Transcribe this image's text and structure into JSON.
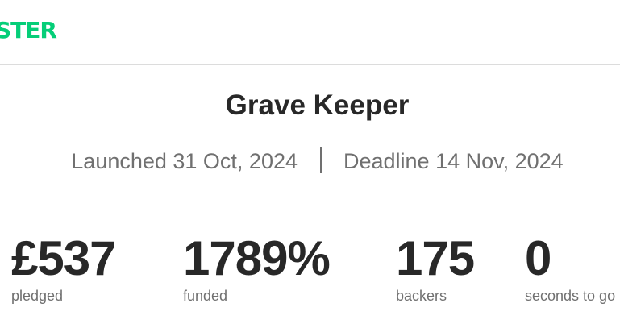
{
  "header": {
    "logo_text": "STER"
  },
  "project": {
    "title": "Grave Keeper",
    "launched": "Launched 31 Oct, 2024",
    "deadline": "Deadline 14 Nov, 2024"
  },
  "stats": {
    "pledged": {
      "value": "£537",
      "label": "pledged"
    },
    "funded": {
      "value": "1789%",
      "label": "funded"
    },
    "backers": {
      "value": "175",
      "label": "backers"
    },
    "time": {
      "value": "0",
      "label": "seconds to go"
    }
  },
  "colors": {
    "brand": "#05ce78",
    "text": "#282828",
    "muted": "#707070"
  }
}
